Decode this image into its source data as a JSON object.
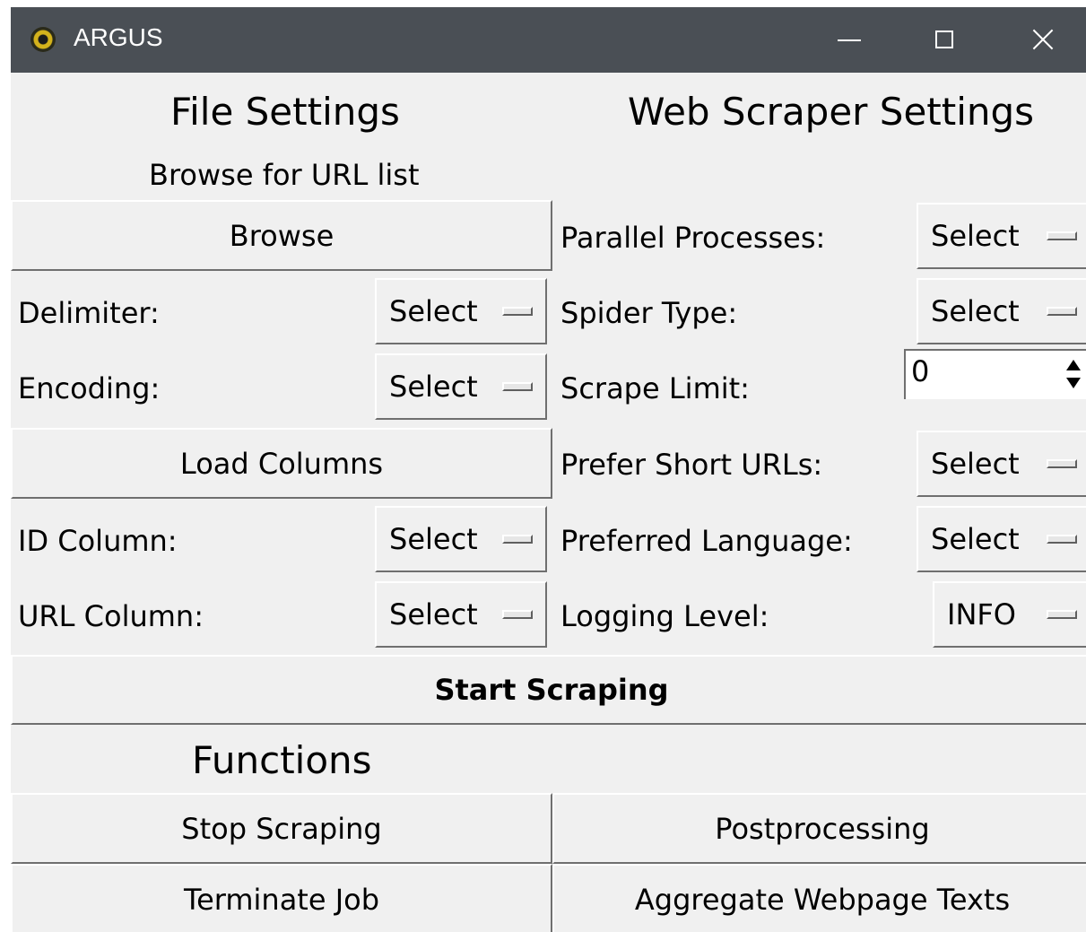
{
  "window": {
    "title": "ARGUS"
  },
  "file_settings": {
    "heading": "File Settings",
    "browse_caption": "Browse for URL list",
    "browse_button": "Browse",
    "delimiter_label": "Delimiter:",
    "delimiter_value": "Select",
    "encoding_label": "Encoding:",
    "encoding_value": "Select",
    "load_columns_button": "Load Columns",
    "id_column_label": "ID Column:",
    "id_column_value": "Select",
    "url_column_label": "URL Column:",
    "url_column_value": "Select"
  },
  "scraper_settings": {
    "heading": "Web Scraper Settings",
    "parallel_label": "Parallel Processes:",
    "parallel_value": "Select",
    "spider_label": "Spider Type:",
    "spider_value": "Select",
    "limit_label": "Scrape Limit:",
    "limit_value": "0",
    "short_urls_label": "Prefer Short URLs:",
    "short_urls_value": "Select",
    "language_label": "Preferred Language:",
    "language_value": "Select",
    "logging_label": "Logging Level:",
    "logging_value": "INFO"
  },
  "start_button": "Start Scraping",
  "functions": {
    "heading": "Functions",
    "stop_button": "Stop Scraping",
    "postprocessing_button": "Postprocessing",
    "terminate_button": "Terminate Job",
    "aggregate_button": "Aggregate Webpage Texts"
  }
}
